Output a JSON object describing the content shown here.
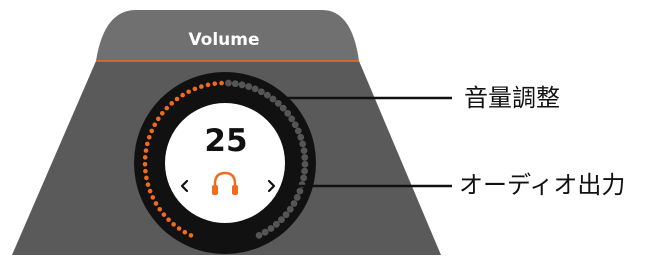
{
  "panel": {
    "title": "Volume",
    "volume_value": "25",
    "volume_level": 0.5,
    "prev_icon": "chevron-left-icon",
    "next_icon": "chevron-right-icon",
    "output_icon": "headphones-icon"
  },
  "callouts": {
    "volume_adjust": "音量調整",
    "audio_output": "オーディオ出力"
  },
  "colors": {
    "header_bg": "#6f6f6f",
    "body_bg": "#5a5a5a",
    "accent": "#f26b1d",
    "dial_bg": "#111111",
    "dot_inactive": "#555555",
    "text_light": "#ffffff"
  }
}
